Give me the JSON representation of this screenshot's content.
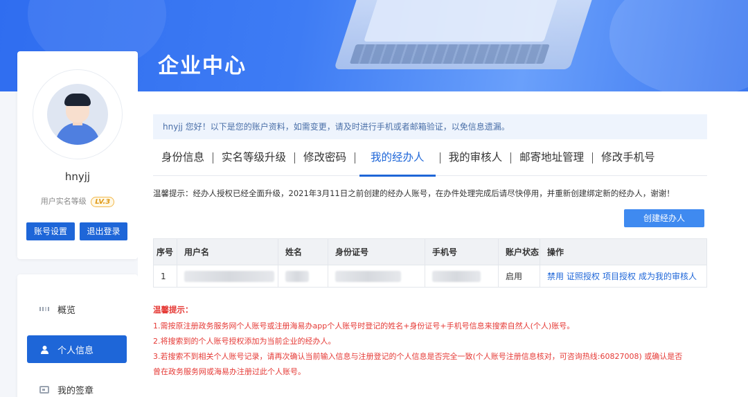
{
  "banner": {
    "title": "企业中心"
  },
  "profile": {
    "username": "hnyjj",
    "level_label": "用户实名等级",
    "level_badge": "LV.3",
    "account_settings": "账号设置",
    "logout": "退出登录"
  },
  "nav": {
    "items": [
      {
        "label": "概览",
        "icon": "grid-icon"
      },
      {
        "label": "个人信息",
        "icon": "user-icon"
      },
      {
        "label": "我的签章",
        "icon": "seal-icon"
      }
    ]
  },
  "main": {
    "notice": "hnyjj 您好！以下是您的账户资料，如需变更，请及时进行手机或者邮箱验证，以免信息遗漏。",
    "tabs": [
      "身份信息",
      "实名等级升级",
      "修改密码",
      "我的经办人",
      "我的审核人",
      "邮寄地址管理",
      "修改手机号"
    ],
    "active_tab": "我的经办人",
    "tip": "温馨提示：经办人授权已经全面升级，2021年3月11日之前创建的经办人账号，在办件处理完成后请尽快停用，并重新创建绑定新的经办人，谢谢！",
    "create_button": "创建经办人",
    "table": {
      "headers": [
        "序号",
        "用户名",
        "姓名",
        "身份证号",
        "手机号",
        "账户状态",
        "操作"
      ],
      "rows": [
        {
          "index": "1",
          "status": "启用",
          "ops": [
            "禁用",
            "证照授权",
            "项目授权",
            "成为我的审核人"
          ]
        }
      ]
    },
    "warnings": {
      "title": "温馨提示：",
      "lines": [
        "1.需按原注册政务服务网个人账号或注册海易办app个人账号时登记的姓名+身份证号+手机号信息来搜索自然人(个人)账号。",
        "2.将搜索到的个人账号授权添加为当前企业的经办人。",
        "3.若搜索不到相关个人账号记录，请再次确认当前输入信息与注册登记的个人信息是否完全一致(个人账号注册信息核对，可咨询热线:60827008) 或确认是否",
        "曾在政务服务网或海易办注册过此个人账号。"
      ]
    }
  },
  "colors": {
    "primary": "#1e66d8",
    "warning": "#e53935",
    "notice_bg": "#eef4fd"
  }
}
